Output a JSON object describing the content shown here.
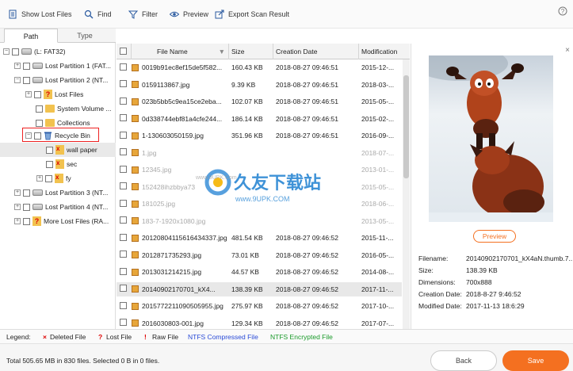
{
  "toolbar": {
    "show_lost_files": "Show Lost Files",
    "find": "Find",
    "filter": "Filter",
    "preview": "Preview",
    "export_scan_result": "Export Scan Result"
  },
  "tabs": {
    "path": "Path",
    "type": "Type"
  },
  "tree": [
    {
      "label": "(L: FAT32)"
    },
    {
      "label": "Lost Partition 1 (FAT..."
    },
    {
      "label": "Lost Partition 2 (NT..."
    },
    {
      "label": "Lost Files"
    },
    {
      "label": "System Volume ..."
    },
    {
      "label": "Collections"
    },
    {
      "label": "Recycle Bin"
    },
    {
      "label": "wall paper"
    },
    {
      "label": "sec"
    },
    {
      "label": "fy"
    },
    {
      "label": "Lost Partition 3 (NT..."
    },
    {
      "label": "Lost Partition 4 (NT..."
    },
    {
      "label": "More Lost Files (RA..."
    }
  ],
  "table": {
    "columns": [
      "File Name",
      "Size",
      "Creation Date",
      "Modification"
    ],
    "rows": [
      {
        "name": "0019b91ec8ef15de5f582...",
        "size": "160.43 KB",
        "created": "2018-08-27 09:46:51",
        "modified": "2015-12-..."
      },
      {
        "name": "0159113867.jpg",
        "size": "9.39 KB",
        "created": "2018-08-27 09:46:51",
        "modified": "2018-03-..."
      },
      {
        "name": "023b5bb5c9ea15ce2eba...",
        "size": "102.07 KB",
        "created": "2018-08-27 09:46:51",
        "modified": "2015-05-..."
      },
      {
        "name": "0d338744ebf81a4cfe244...",
        "size": "186.14 KB",
        "created": "2018-08-27 09:46:51",
        "modified": "2015-02-..."
      },
      {
        "name": "1-130603050159.jpg",
        "size": "351.96 KB",
        "created": "2018-08-27 09:46:51",
        "modified": "2016-09-..."
      },
      {
        "name": "1.jpg",
        "size": "",
        "created": "",
        "modified": "2018-07-..."
      },
      {
        "name": "12345.jpg",
        "size": "",
        "created": "",
        "modified": "2013-01-..."
      },
      {
        "name": "152428ihzbbya73",
        "size": "",
        "created": "",
        "modified": "2015-05-..."
      },
      {
        "name": "181025.jpg",
        "size": "",
        "created": "",
        "modified": "2018-06-..."
      },
      {
        "name": "183-7-1920x1080.jpg",
        "size": "",
        "created": "",
        "modified": "2013-05-..."
      },
      {
        "name": "20120804115616434337.jpg",
        "size": "481.54 KB",
        "created": "2018-08-27 09:46:52",
        "modified": "2015-11-..."
      },
      {
        "name": "2012871735293.jpg",
        "size": "73.01 KB",
        "created": "2018-08-27 09:46:52",
        "modified": "2016-05-..."
      },
      {
        "name": "2013031214215.jpg",
        "size": "44.57 KB",
        "created": "2018-08-27 09:46:52",
        "modified": "2014-08-..."
      },
      {
        "name": "20140902170701_kX4...",
        "size": "138.39 KB",
        "created": "2018-08-27 09:46:52",
        "modified": "2017-11-..."
      },
      {
        "name": "2015772211090505955.jpg",
        "size": "275.97 KB",
        "created": "2018-08-27 09:46:52",
        "modified": "2017-10-..."
      },
      {
        "name": "2016030803-001.jpg",
        "size": "129.34 KB",
        "created": "2018-08-27 09:46:52",
        "modified": "2017-07-..."
      }
    ]
  },
  "preview": {
    "button": "Preview",
    "info": [
      {
        "k": "Filename:",
        "v": "20140902170701_kX4aN.thumb.7..."
      },
      {
        "k": "Size:",
        "v": "138.39 KB"
      },
      {
        "k": "Dimensions:",
        "v": "700x888"
      },
      {
        "k": "Creation Date:",
        "v": "2018-8-27 9:46:52"
      },
      {
        "k": "Modified Date:",
        "v": "2017-11-13 18:6:29"
      }
    ]
  },
  "legend": {
    "title": "Legend:",
    "deleted": "Deleted File",
    "lost": "Lost File",
    "raw": "Raw File",
    "ntfs_compressed": "NTFS Compressed File",
    "ntfs_encrypted": "NTFS Encrypted File",
    "colors": {
      "deleted": "#d00000",
      "compressed": "#2a4bd7",
      "encrypted": "#1a9a2a"
    }
  },
  "watermark": {
    "brand": "久友下载站",
    "url": "www.9UPK.Com"
  },
  "footer": {
    "text": "Total 505.65 MB in 830 files.  Selected 0 B in 0 files.",
    "back": "Back",
    "save": "Save"
  }
}
